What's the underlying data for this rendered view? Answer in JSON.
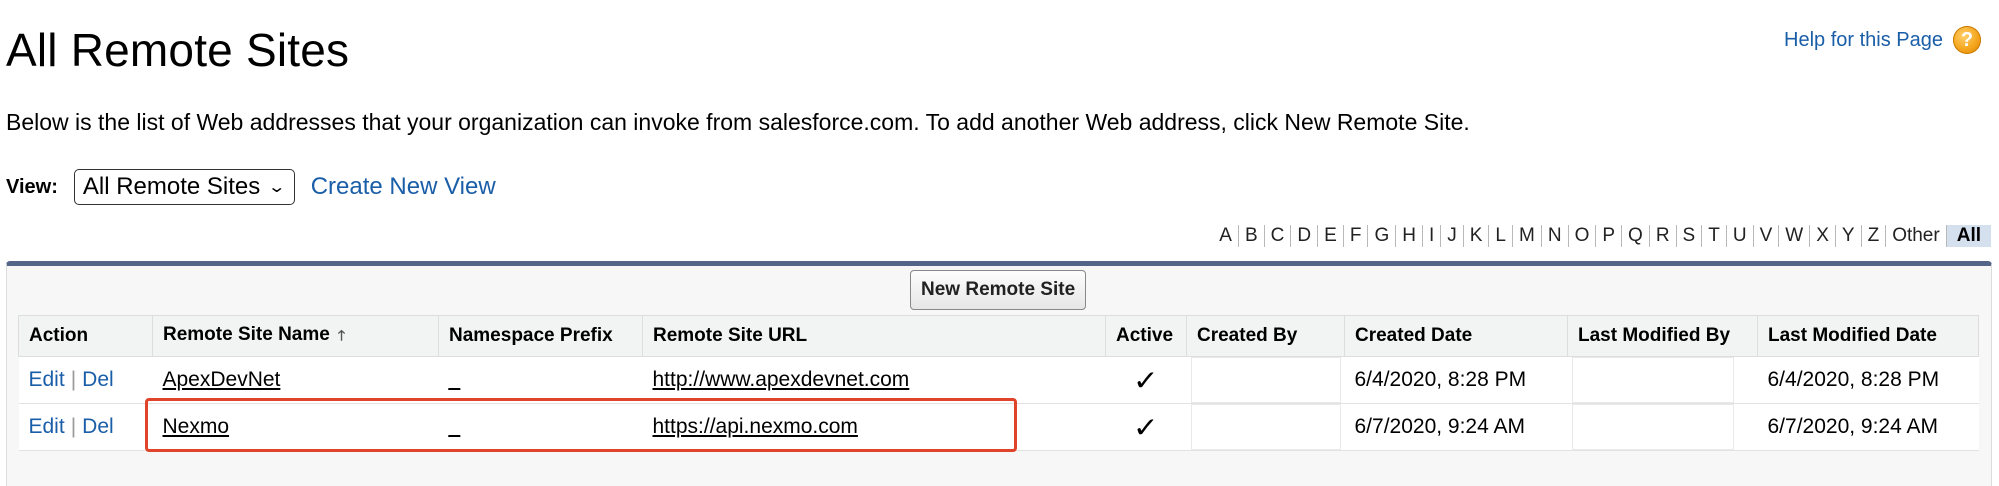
{
  "page": {
    "title": "All Remote Sites",
    "help_label": "Help for this Page",
    "help_icon": "question-icon",
    "description": "Below is the list of Web addresses that your organization can invoke from salesforce.com. To add another Web address, click New Remote Site."
  },
  "view": {
    "label": "View:",
    "selected": "All Remote Sites",
    "create_link": "Create New View"
  },
  "alphabet": {
    "letters": [
      "A",
      "B",
      "C",
      "D",
      "E",
      "F",
      "G",
      "H",
      "I",
      "J",
      "K",
      "L",
      "M",
      "N",
      "O",
      "P",
      "Q",
      "R",
      "S",
      "T",
      "U",
      "V",
      "W",
      "X",
      "Y",
      "Z",
      "Other",
      "All"
    ],
    "active": "All"
  },
  "list": {
    "new_button": "New Remote Site",
    "columns": [
      "Action",
      "Remote Site Name",
      "Namespace Prefix",
      "Remote Site URL",
      "Active",
      "Created By",
      "Created Date",
      "Last Modified By",
      "Last Modified Date"
    ],
    "sorted_column": "Remote Site Name",
    "rows": [
      {
        "edit": "Edit",
        "del": "Del",
        "name": "ApexDevNet",
        "namespace": "_",
        "url": "http://www.apexdevnet.com",
        "active": true,
        "created_date": "6/4/2020, 8:28 PM",
        "modified_date": "6/4/2020, 8:28 PM"
      },
      {
        "edit": "Edit",
        "del": "Del",
        "name": "Nexmo",
        "namespace": "_",
        "url": "https://api.nexmo.com",
        "active": true,
        "created_date": "6/7/2020, 9:24 AM",
        "modified_date": "6/7/2020, 9:24 AM"
      }
    ]
  },
  "colors": {
    "link": "#1a5ea8",
    "panel_border": "#55658a",
    "highlight": "#e0452b",
    "alpha_active_bg": "#d5e0ef"
  }
}
